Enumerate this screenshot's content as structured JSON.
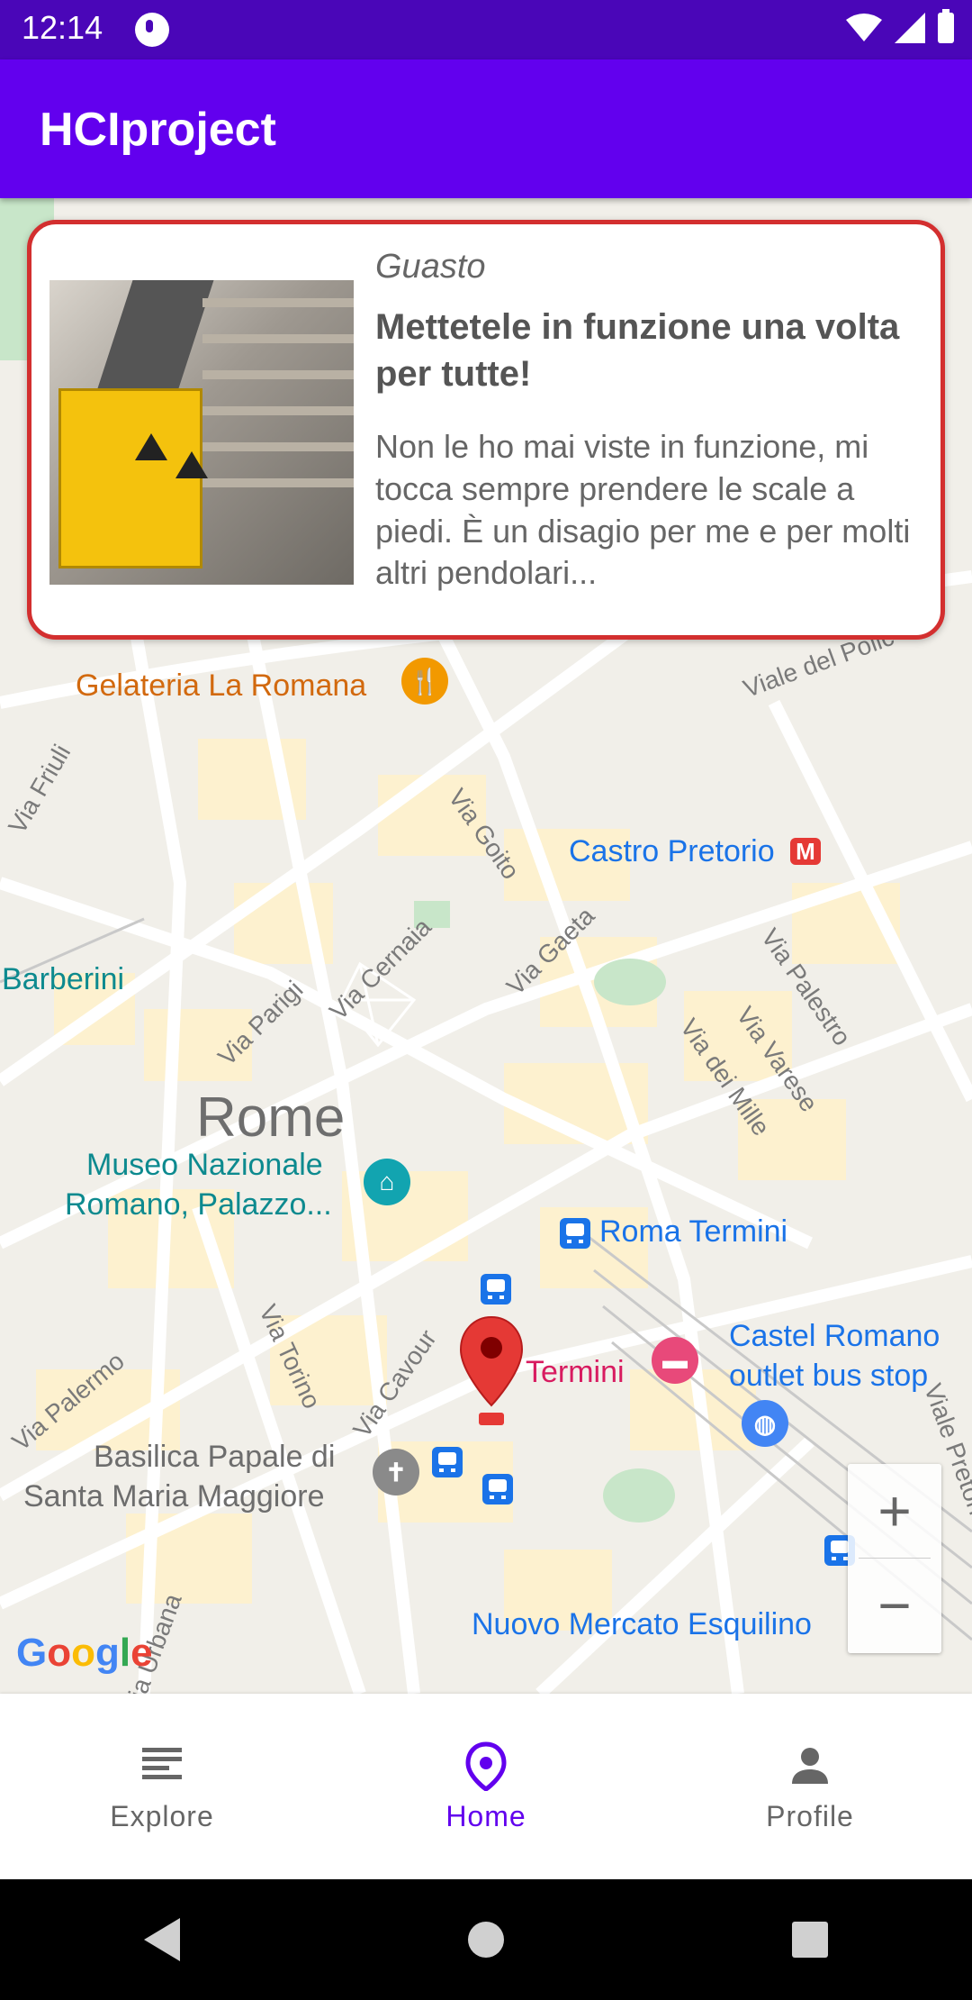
{
  "status_bar": {
    "time": "12:14",
    "icons": [
      "app-notification-icon",
      "wifi-icon",
      "signal-icon",
      "battery-icon"
    ]
  },
  "app_bar": {
    "title": "HCIproject"
  },
  "issue_card": {
    "category": "Guasto",
    "title": "Mettetele in funzione una volta per tutte!",
    "body": "Non le ho mai viste in funzione, mi tocca sempre prendere le scale a piedi. È un disagio per me e per molti altri pendolari...",
    "border_color": "#d32f2f"
  },
  "map": {
    "city": "Rome",
    "places": {
      "gelateria": "Gelateria La Romana",
      "castro_pretorio": "Castro Pretorio",
      "barberini": "Barberini",
      "museo": "Museo Nazionale",
      "museo2": "Romano, Palazzo...",
      "roma_termini": "Roma Termini",
      "termini": "Termini",
      "castel_romano": "Castel Romano",
      "castel_romano2": "outlet bus stop",
      "basilica": "Basilica Papale di",
      "basilica2": "Santa Maria Maggiore",
      "nuovo_mercato": "Nuovo Mercato Esquilino"
    },
    "streets": {
      "viale_del_policlinico": "Viale del Polic",
      "via_goito": "Via Goito",
      "via_cernaia": "Via Cernaia",
      "via_gaeta": "Via Gaeta",
      "via_parigi": "Via Parigi",
      "via_palestro": "Via Palestro",
      "via_varese": "Via Varese",
      "via_dei_mille": "Via dei Mille",
      "viale_pretoriano": "Viale Pretoria",
      "via_torino": "Via Torino",
      "via_cavour": "Via Cavour",
      "via_palermo": "Via Palermo",
      "via_urbana": "Via Urbana",
      "via_friuli": "Via Friuli"
    },
    "metro_badge": "M",
    "google_logo": "Google",
    "zoom_in": "+",
    "zoom_out": "−"
  },
  "bottom_nav": {
    "items": [
      {
        "label": "Explore",
        "icon": "list-icon",
        "active": false
      },
      {
        "label": "Home",
        "icon": "location-icon",
        "active": true
      },
      {
        "label": "Profile",
        "icon": "person-icon",
        "active": false
      }
    ],
    "active_color": "#6200ee",
    "inactive_color": "#666666"
  },
  "system_nav": {
    "icons": [
      "back-icon",
      "home-circle-icon",
      "recents-icon"
    ]
  }
}
